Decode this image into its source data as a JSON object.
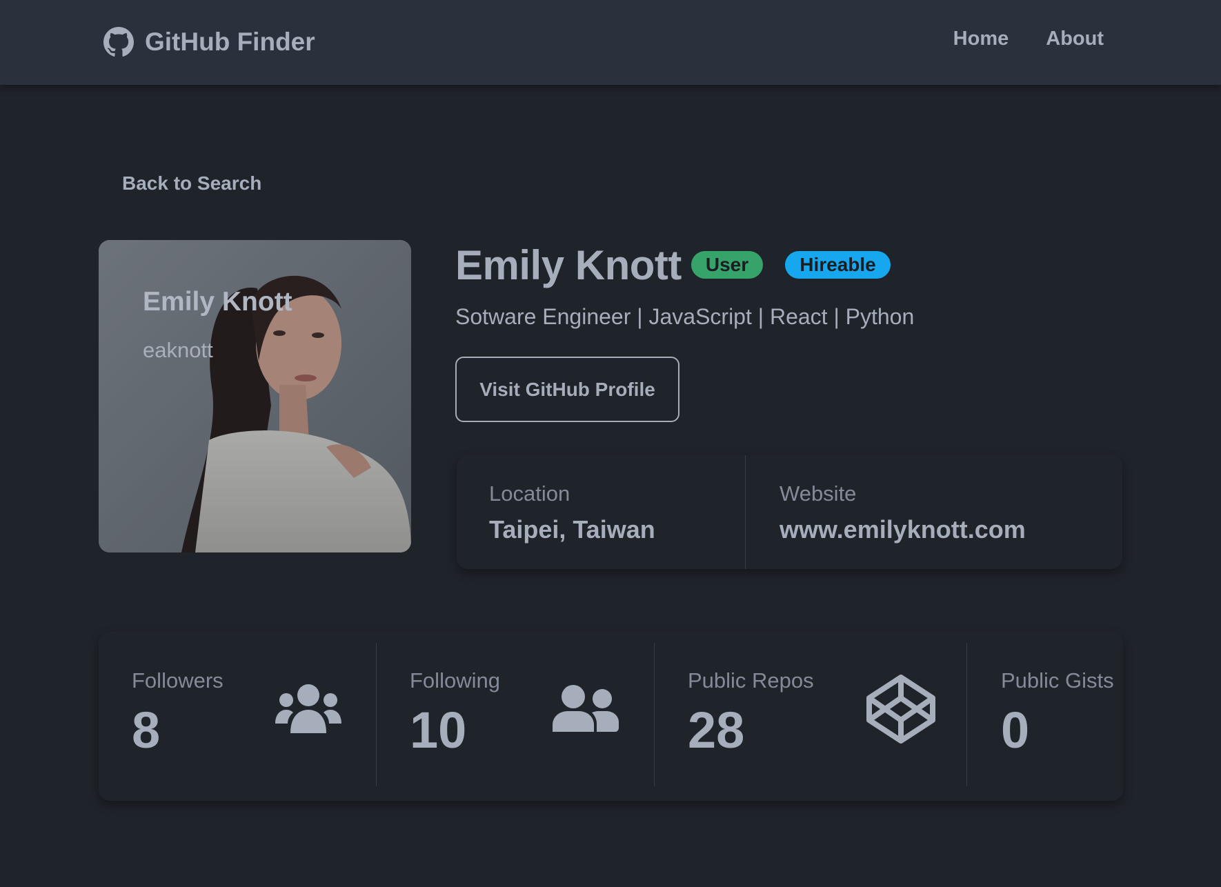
{
  "nav": {
    "brand": "GitHub Finder",
    "links": [
      "Home",
      "About"
    ]
  },
  "back_label": "Back to Search",
  "avatar": {
    "name": "Emily Knott",
    "login": "eaknott"
  },
  "profile": {
    "name": "Emily Knott",
    "badges": [
      "User",
      "Hireable"
    ],
    "bio": "Sotware Engineer | JavaScript | React | Python",
    "visit_label": "Visit GitHub Profile"
  },
  "info": [
    {
      "label": "Location",
      "value": "Taipei, Taiwan"
    },
    {
      "label": "Website",
      "value": "www.emilyknott.com"
    }
  ],
  "stats": [
    {
      "label": "Followers",
      "value": "8",
      "icon": "users-icon"
    },
    {
      "label": "Following",
      "value": "10",
      "icon": "user-friends-icon"
    },
    {
      "label": "Public Repos",
      "value": "28",
      "icon": "codepen-icon"
    },
    {
      "label": "Public Gists",
      "value": "0",
      "icon": "store-icon"
    }
  ],
  "colors": {
    "background": "#1f232a",
    "navbar": "#2a303c",
    "text": "#a6adbb",
    "badge_user": "#36a46a",
    "badge_hireable": "#16a7ee"
  }
}
